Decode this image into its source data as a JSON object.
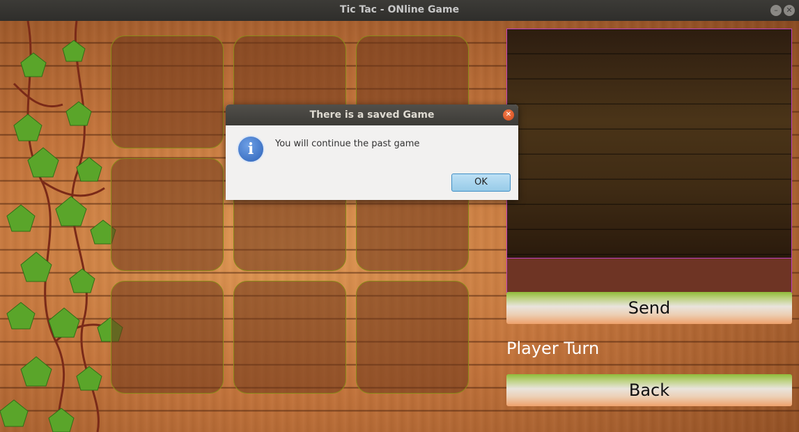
{
  "window": {
    "title": "Tic Tac - ONline Game",
    "minimize_icon": "minimize-icon",
    "close_icon": "close-icon"
  },
  "board": {
    "cells": [
      "",
      "",
      "",
      "",
      "",
      "",
      "",
      "",
      ""
    ]
  },
  "panel": {
    "chat_text": "",
    "message_input": "",
    "send_label": "Send",
    "turn_label": "Player Turn",
    "back_label": "Back"
  },
  "dialog": {
    "title": "There is a saved Game",
    "message": "You will continue the past game",
    "ok_label": "OK",
    "icon": "info-icon"
  },
  "colors": {
    "accent_border": "#c040c0",
    "cell_border": "#8a8a18",
    "button_green": "#8fbb3a",
    "button_peach": "#eea16c"
  }
}
